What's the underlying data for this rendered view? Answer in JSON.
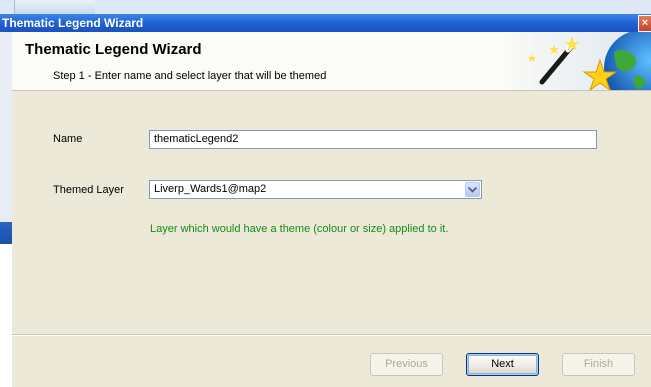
{
  "window": {
    "title": "Thematic Legend Wizard",
    "close_glyph": "×"
  },
  "header": {
    "title": "Thematic Legend Wizard",
    "step": "Step 1 - Enter name and select layer that will be themed",
    "art_icon": "magic-wand-globe-icon"
  },
  "form": {
    "name_label": "Name",
    "name_value": "thematicLegend2",
    "layer_label": "Themed Layer",
    "layer_value": "Liverp_Wards1@map2",
    "layer_hint": "Layer which would have a theme (colour or size) applied to it."
  },
  "buttons": {
    "previous": "Previous",
    "next": "Next",
    "finish": "Finish"
  },
  "colors": {
    "titlebar": "#1f5fd0",
    "hint": "#188a18",
    "dialog_bg": "#ece9d8"
  }
}
